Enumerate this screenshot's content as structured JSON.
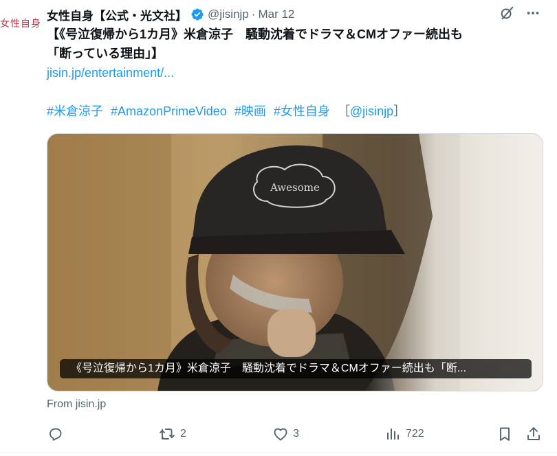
{
  "avatar": {
    "text": "女性自身"
  },
  "header": {
    "author": "女性自身【公式・光文社】",
    "handle": "@jisinjp",
    "separator": "·",
    "date": "Mar 12"
  },
  "tweet": {
    "line1": "【《号泣復帰から1カ月》米倉涼子　騒動沈着でドラマ＆CMオファー続出も",
    "line2": "「断っている理由」】",
    "link": "jisin.jp/entertainment/...",
    "hashtags": [
      "#米倉涼子",
      "#AmazonPrimeVideo",
      "#映画",
      "#女性自身"
    ],
    "mention_open": "［",
    "mention": "@jisinjp",
    "mention_close": "］"
  },
  "media": {
    "caption": "《号泣復帰から1カ月》米倉涼子　騒動沈着でドラマ＆CMオファー続出も「断...",
    "cap_text": "Awesome"
  },
  "source": "From jisin.jp",
  "actions": {
    "reply_count": "",
    "retweet_count": "2",
    "like_count": "3",
    "views_count": "722"
  },
  "colors": {
    "accent": "#1d9bf0",
    "muted": "#536471",
    "avatar_text": "#c4324e"
  },
  "icons": [
    "verified-icon",
    "grok-icon",
    "more-icon",
    "reply-icon",
    "retweet-icon",
    "like-icon",
    "views-icon",
    "bookmark-icon",
    "share-icon"
  ]
}
